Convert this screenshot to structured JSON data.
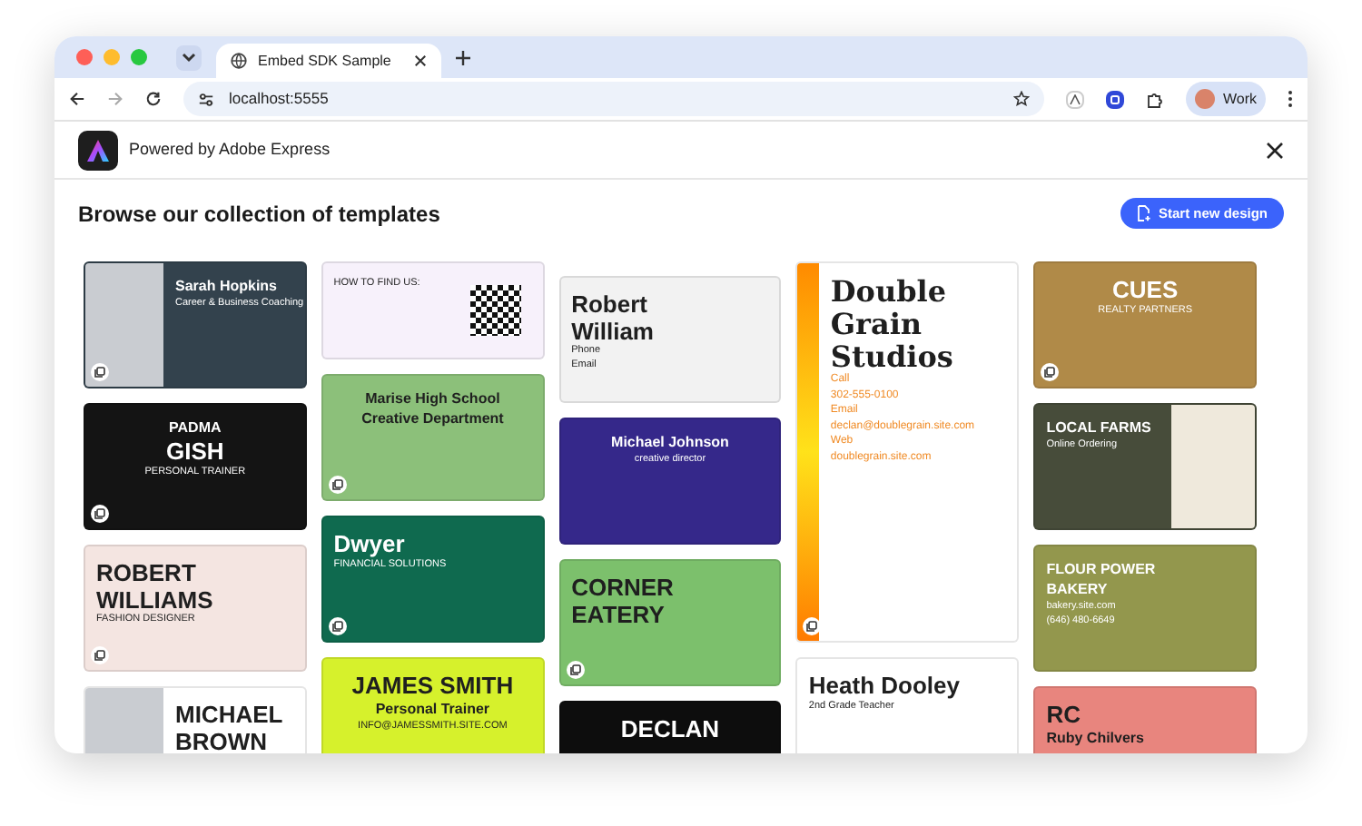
{
  "browser": {
    "tab": {
      "title": "Embed SDK Sample"
    },
    "address": "localhost:5555",
    "profile": "Work"
  },
  "header": {
    "brand": "Powered by Adobe Express"
  },
  "page": {
    "title": "Browse our collection of templates",
    "action": "Start new design"
  },
  "columns": [
    {
      "cards": [
        {
          "kind": "photo-left",
          "color": "#33424d",
          "centered": false,
          "remix_badge": true,
          "lines": [
            {
              "text": "Sarah Hopkins",
              "kind": "subtitle"
            },
            {
              "text": "Career & Business Coaching",
              "kind": "detail"
            }
          ]
        },
        {
          "kind": "plain",
          "color": "#141414",
          "centered": true,
          "remix_badge": true,
          "lines": [
            {
              "text": "PADMA",
              "kind": "subtitle"
            },
            {
              "text": "GISH",
              "kind": "title"
            },
            {
              "text": "PERSONAL TRAINER",
              "kind": "detail"
            }
          ]
        },
        {
          "kind": "plain",
          "color": "#f4e5e1",
          "centered": false,
          "remix_badge": true,
          "lines": [
            {
              "text": "ROBERT",
              "kind": "title"
            },
            {
              "text": "WILLIAMS",
              "kind": "title"
            },
            {
              "text": "FASHION DESIGNER",
              "kind": "detail"
            }
          ]
        },
        {
          "kind": "photo-left",
          "color": "#ffffff",
          "centered": false,
          "remix_badge": false,
          "lines": [
            {
              "text": "MICHAEL",
              "kind": "title"
            },
            {
              "text": "BROWN",
              "kind": "title"
            }
          ]
        }
      ]
    },
    {
      "cards": [
        {
          "kind": "qr-right",
          "color": "#f7f1fb",
          "centered": false,
          "remix_badge": false,
          "lines": [
            {
              "text": "HOW TO FIND US:",
              "kind": "detail"
            }
          ]
        },
        {
          "kind": "plain",
          "color": "#8cc07a",
          "centered": true,
          "remix_badge": true,
          "lines": [
            {
              "text": "Marise High School",
              "kind": "subtitle"
            },
            {
              "text": "Creative Department",
              "kind": "subtitle"
            }
          ]
        },
        {
          "kind": "plain",
          "color": "#0f6a4f",
          "centered": false,
          "remix_badge": true,
          "lines": [
            {
              "text": "Dwyer",
              "kind": "title"
            },
            {
              "text": "FINANCIAL SOLUTIONS",
              "kind": "detail"
            }
          ]
        },
        {
          "kind": "plain",
          "color": "#d6f12c",
          "centered": true,
          "remix_badge": false,
          "lines": [
            {
              "text": "JAMES SMITH",
              "kind": "title"
            },
            {
              "text": "Personal Trainer",
              "kind": "subtitle"
            },
            {
              "text": "INFO@JAMESSMITH.SITE.COM",
              "kind": "detail"
            }
          ]
        }
      ]
    },
    {
      "cards": [
        {
          "kind": "plain",
          "color": "#f2f2f2",
          "centered": false,
          "remix_badge": false,
          "lines": [
            {
              "text": "Robert",
              "kind": "title"
            },
            {
              "text": "William",
              "kind": "title"
            },
            {
              "text": "Phone",
              "kind": "detail"
            },
            {
              "text": "Email",
              "kind": "detail"
            }
          ]
        },
        {
          "kind": "plain",
          "color": "#35288a",
          "centered": true,
          "remix_badge": false,
          "lines": [
            {
              "text": "Michael Johnson",
              "kind": "subtitle"
            },
            {
              "text": "creative director",
              "kind": "detail"
            }
          ]
        },
        {
          "kind": "plain",
          "color": "#7cc06c",
          "centered": false,
          "remix_badge": true,
          "lines": [
            {
              "text": "CORNER",
              "kind": "title"
            },
            {
              "text": "EATERY",
              "kind": "title"
            }
          ]
        },
        {
          "kind": "plain",
          "color": "#0d0d0d",
          "centered": true,
          "remix_badge": false,
          "lines": [
            {
              "text": "DECLAN",
              "kind": "title"
            }
          ]
        }
      ]
    },
    {
      "cards": [
        {
          "kind": "stripe-left",
          "color": "#ffffff",
          "centered": false,
          "remix_badge": true,
          "lines": [
            {
              "text": "Double",
              "kind": "title"
            },
            {
              "text": "Grain",
              "kind": "title"
            },
            {
              "text": "Studios",
              "kind": "title"
            },
            {
              "text": "Call",
              "kind": "accent"
            },
            {
              "text": "302-555-0100",
              "kind": "accent"
            },
            {
              "text": "Email",
              "kind": "accent"
            },
            {
              "text": "declan@doublegrain.site.com",
              "kind": "accent"
            },
            {
              "text": "Web",
              "kind": "accent"
            },
            {
              "text": "doublegrain.site.com",
              "kind": "accent"
            }
          ]
        },
        {
          "kind": "plain",
          "color": "#ffffff",
          "centered": false,
          "remix_badge": false,
          "lines": [
            {
              "text": "Heath Dooley",
              "kind": "title"
            },
            {
              "text": "2nd Grade Teacher",
              "kind": "detail"
            }
          ]
        }
      ]
    },
    {
      "cards": [
        {
          "kind": "plain",
          "color": "#b08a48",
          "centered": true,
          "remix_badge": true,
          "lines": [
            {
              "text": "CUES",
              "kind": "title"
            },
            {
              "text": "REALTY PARTNERS",
              "kind": "detail"
            }
          ]
        },
        {
          "kind": "pattern-right",
          "color": "#474c3a",
          "centered": false,
          "remix_badge": false,
          "lines": [
            {
              "text": "LOCAL FARMS",
              "kind": "subtitle"
            },
            {
              "text": "Online Ordering",
              "kind": "detail"
            }
          ]
        },
        {
          "kind": "plain",
          "color": "#93974d",
          "centered": false,
          "remix_badge": false,
          "lines": [
            {
              "text": "FLOUR POWER",
              "kind": "subtitle"
            },
            {
              "text": "BAKERY",
              "kind": "subtitle"
            },
            {
              "text": "bakery.site.com",
              "kind": "detail"
            },
            {
              "text": "(646) 480-6649",
              "kind": "detail"
            }
          ]
        },
        {
          "kind": "plain",
          "color": "#e8857e",
          "centered": false,
          "remix_badge": false,
          "lines": [
            {
              "text": "RC",
              "kind": "title"
            },
            {
              "text": "Ruby Chilvers",
              "kind": "subtitle"
            }
          ]
        }
      ]
    }
  ]
}
